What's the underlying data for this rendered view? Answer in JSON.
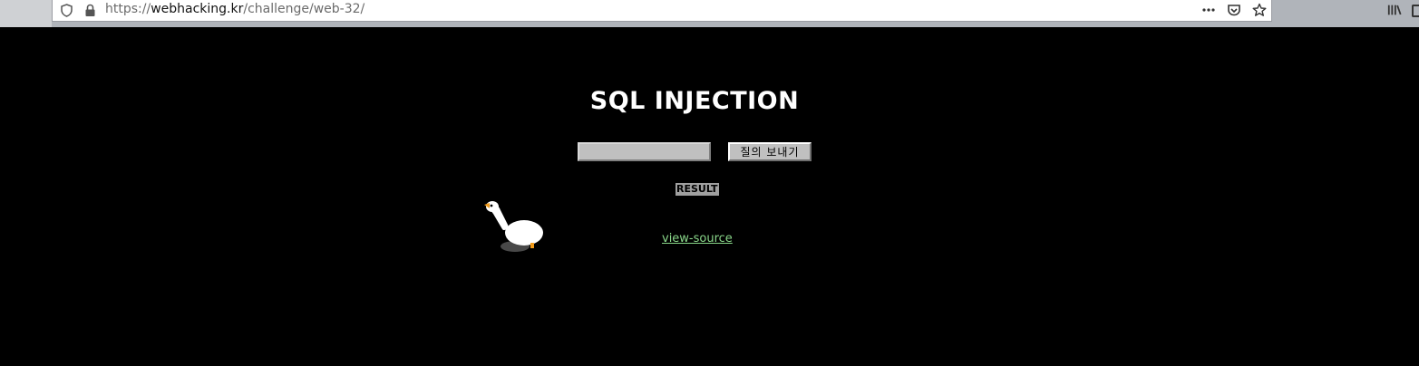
{
  "browser": {
    "url_prefix": "https://",
    "url_host": "webhacking.kr",
    "url_path": "/challenge/web-32/",
    "icons": [
      "shield-icon",
      "lock-icon",
      "more-actions-icon",
      "pocket-icon",
      "bookmark-star-icon",
      "library-icon"
    ]
  },
  "page": {
    "title": "SQL INJECTION",
    "query_input_value": "",
    "submit_label": "질의 보내기",
    "result_label": "RESULT",
    "view_source_label": "view-source"
  },
  "colors": {
    "background": "#000000",
    "title": "#ffffff",
    "link": "#89d689",
    "input_bg": "#c0c0c0",
    "result_bg": "#a0a0a0"
  }
}
